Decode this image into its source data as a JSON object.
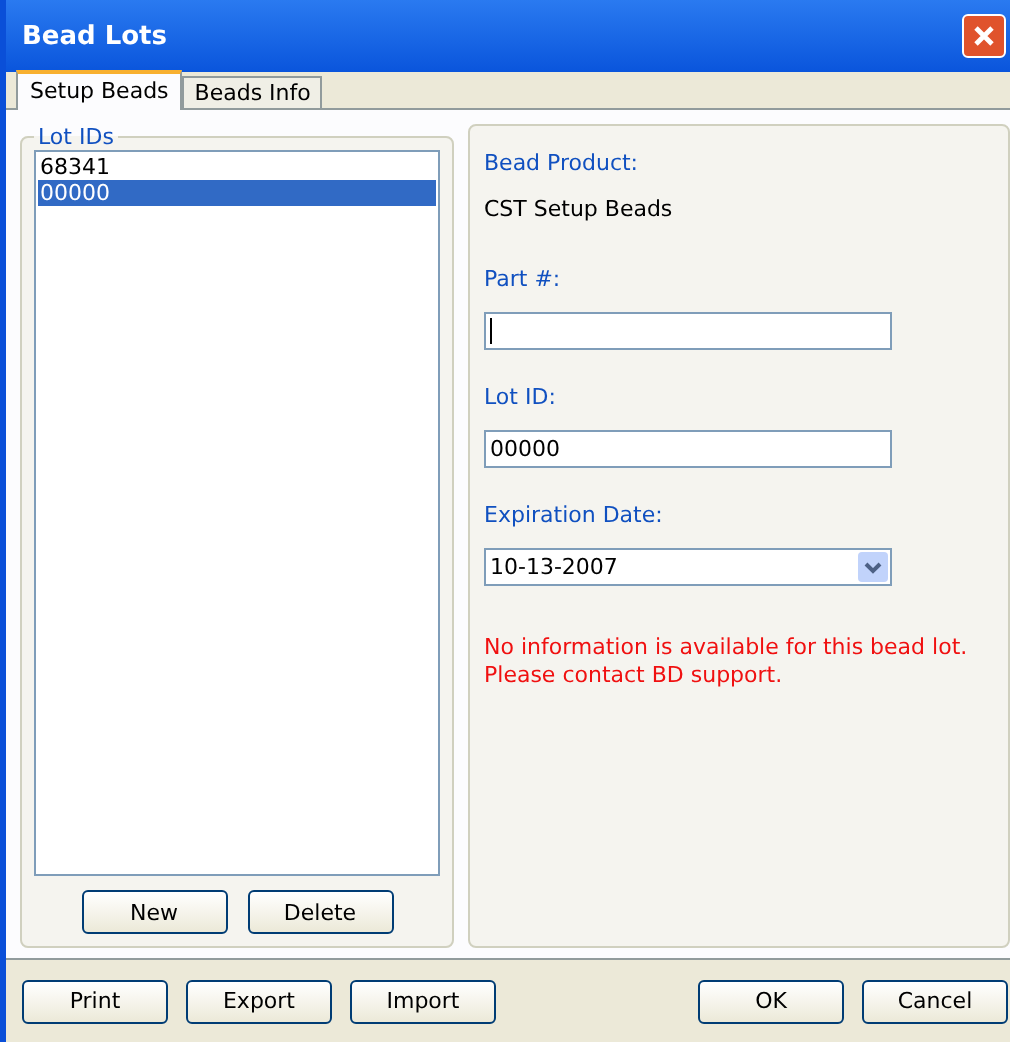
{
  "window": {
    "title": "Bead Lots"
  },
  "tabs": [
    {
      "label": "Setup Beads",
      "selected": true
    },
    {
      "label": "Beads Info",
      "selected": false
    }
  ],
  "lot_ids": {
    "title": "Lot IDs",
    "items": [
      {
        "label": "68341",
        "selected": false
      },
      {
        "label": "00000",
        "selected": true
      }
    ],
    "buttons": [
      "New",
      "Delete"
    ]
  },
  "details": {
    "product_label": "Bead Product:",
    "product_value": "CST Setup Beads",
    "part_label": "Part #:",
    "part_focused": true,
    "lot_label": "Lot ID:",
    "lot_value": "00000",
    "expiration_label": "Expiration Date:",
    "expiration_value": "10-13-2007",
    "message": "No information is available for this bead lot.\nPlease contact BD support."
  },
  "footer": {
    "left_buttons": [
      "Print",
      "Export",
      "Import"
    ],
    "right_buttons": [
      "OK",
      "Cancel"
    ]
  }
}
